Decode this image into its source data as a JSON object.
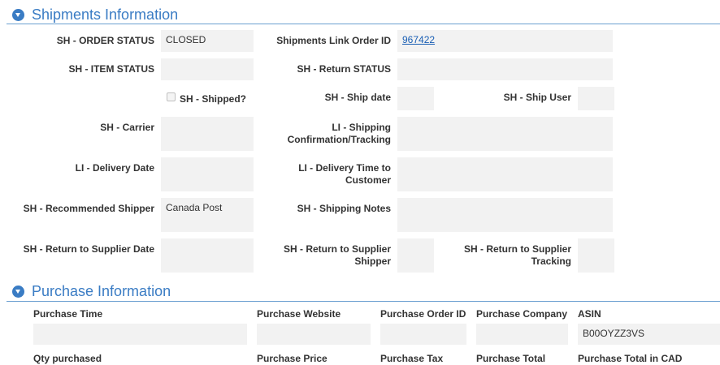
{
  "shipments": {
    "title": "Shipments Information",
    "order_status_label": "SH - ORDER STATUS",
    "order_status_value": "CLOSED",
    "link_order_id_label": "Shipments Link Order ID",
    "link_order_id_value": "967422",
    "item_status_label": "SH - ITEM STATUS",
    "item_status_value": "",
    "return_status_label": "SH - Return STATUS",
    "return_status_value": "",
    "shipped_label": "SH - Shipped?",
    "ship_date_label": "SH - Ship date",
    "ship_date_value": "",
    "ship_user_label": "SH - Ship User",
    "ship_user_value": "",
    "carrier_label": "SH - Carrier",
    "carrier_value": "",
    "tracking_label": "LI - Shipping Confirmation/Tracking",
    "tracking_value": "",
    "delivery_date_label": "LI - Delivery Date",
    "delivery_date_value": "",
    "delivery_time_label": "LI - Delivery Time to Customer",
    "delivery_time_value": "",
    "recommended_shipper_label": "SH - Recommended Shipper",
    "recommended_shipper_value": "Canada Post",
    "shipping_notes_label": "SH - Shipping Notes",
    "shipping_notes_value": "",
    "return_date_label": "SH - Return to Supplier Date",
    "return_date_value": "",
    "return_shipper_label": "SH - Return to Supplier Shipper",
    "return_shipper_value": "",
    "return_tracking_label": "SH - Return to Supplier Tracking",
    "return_tracking_value": ""
  },
  "purchase": {
    "title": "Purchase Information",
    "row1": [
      {
        "label": "Purchase Time",
        "value": ""
      },
      {
        "label": "Purchase Website",
        "value": ""
      },
      {
        "label": "Purchase Order ID",
        "value": ""
      },
      {
        "label": "Purchase Company",
        "value": ""
      },
      {
        "label": "ASIN",
        "value": "B00OYZZ3VS"
      }
    ],
    "row2": [
      {
        "label": "Qty purchased"
      },
      {
        "label": "Purchase Price"
      },
      {
        "label": "Purchase Tax"
      },
      {
        "label": "Purchase Total"
      },
      {
        "label": "Purchase Total in CAD"
      }
    ]
  }
}
